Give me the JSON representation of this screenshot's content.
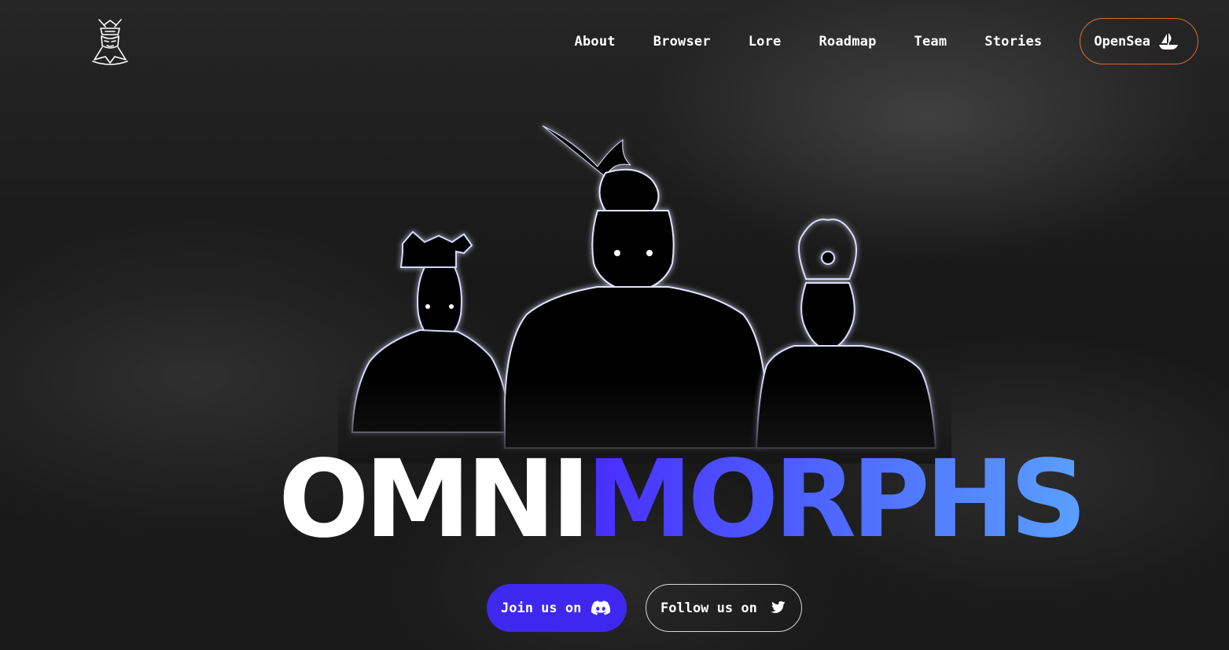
{
  "header": {
    "logo_icon": "omnimorphs-mask-logo",
    "nav": [
      {
        "label": "About"
      },
      {
        "label": "Browser"
      },
      {
        "label": "Lore"
      },
      {
        "label": "Roadmap"
      },
      {
        "label": "Team"
      },
      {
        "label": "Stories"
      }
    ],
    "opensea": {
      "label": "OpenSea",
      "icon": "opensea-ship-icon",
      "border_color": "#d86a3a"
    }
  },
  "hero": {
    "wordmark_part1": "OMNI",
    "wordmark_part2": "MORPHS",
    "wordmark_colors": [
      "#ffffff",
      "#4a2cff",
      "#5aa0ff"
    ]
  },
  "cta": {
    "discord": {
      "label": "Join us on",
      "icon": "discord-icon",
      "bg_color": "#3e28f0"
    },
    "twitter": {
      "label": "Follow us on",
      "icon": "twitter-icon"
    }
  }
}
